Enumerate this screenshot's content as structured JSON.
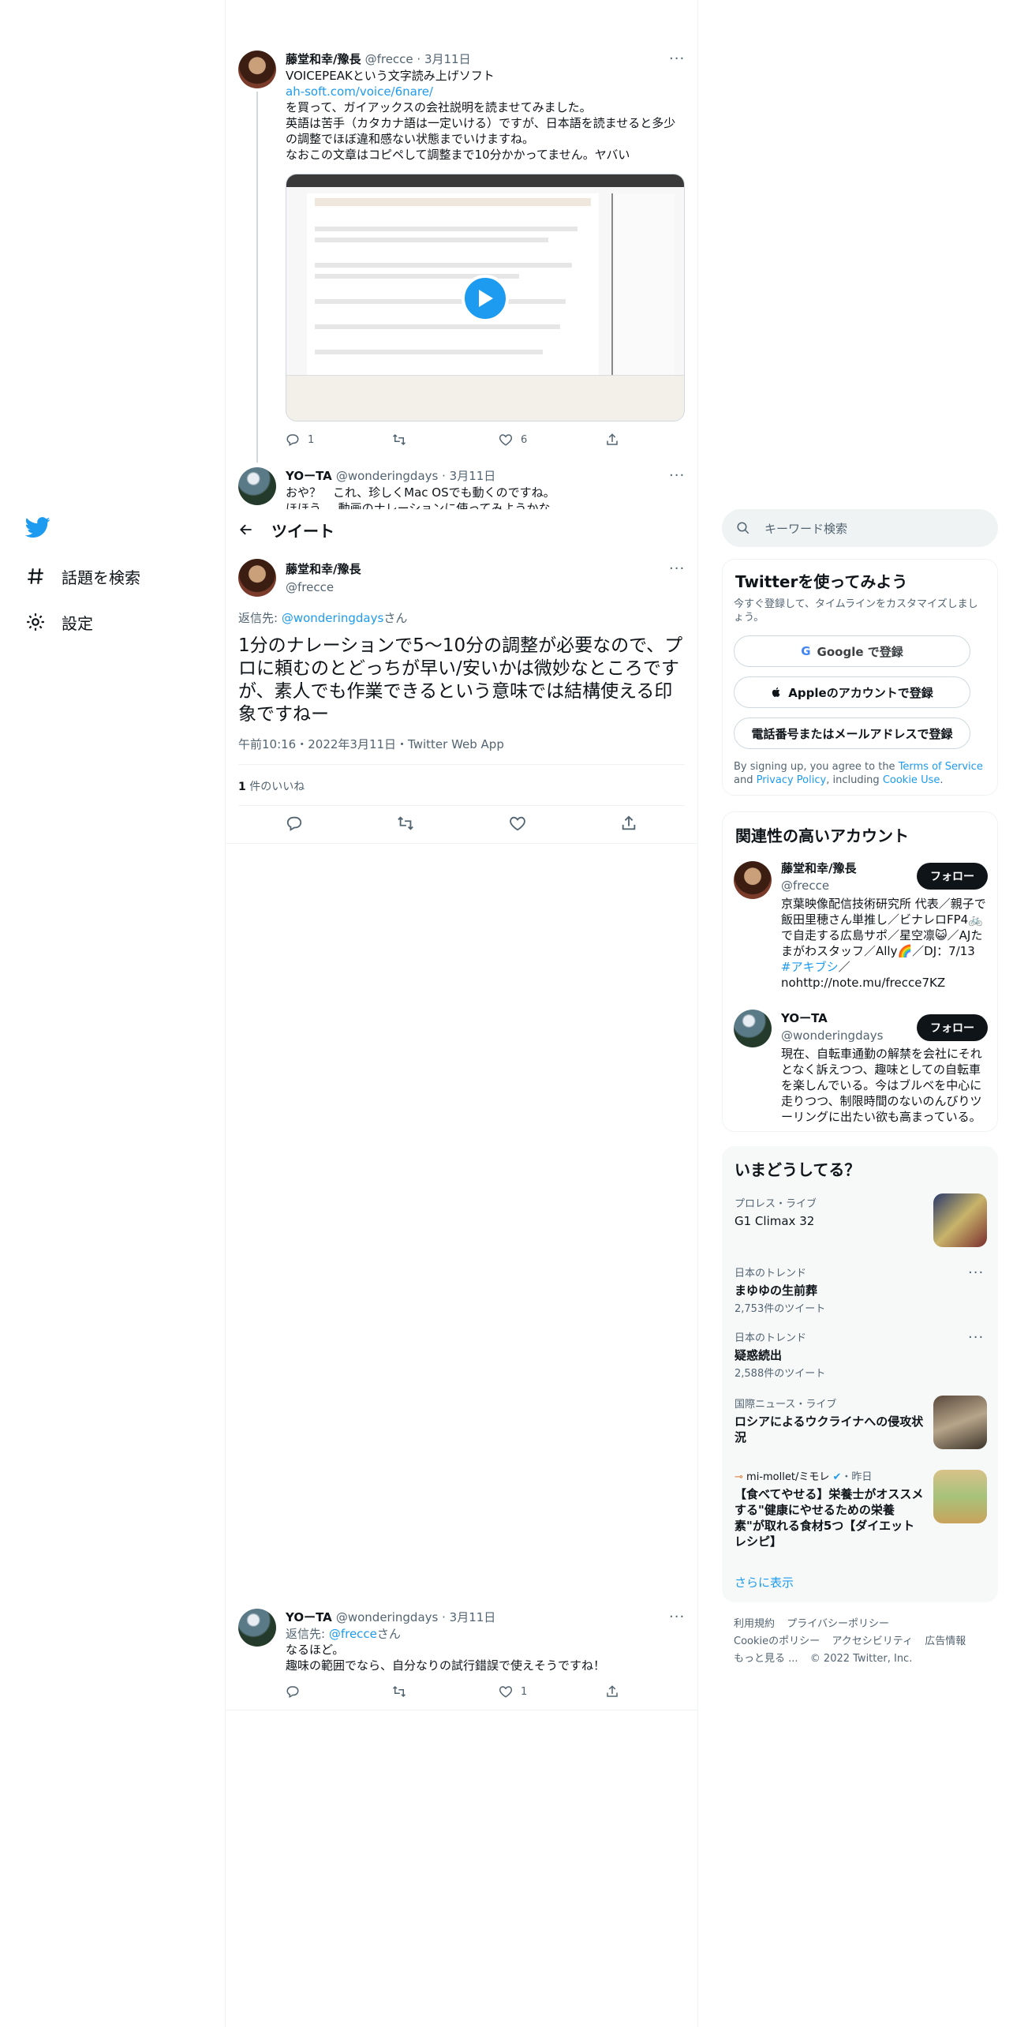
{
  "nav": {
    "explore_label": "話題を検索",
    "settings_label": "設定"
  },
  "header": {
    "title": "ツイート"
  },
  "tweet1": {
    "name": "藤堂和幸/豫長",
    "handle": "@frecce",
    "date": "3月11日",
    "line1": "VOICEPEAKという文字読み上げソフト",
    "link": "ah-soft.com/voice/6nare/",
    "line2": "を買って、ガイアックスの会社説明を読ませてみました。",
    "line3": "英語は苦手（カタカナ語は一定いける）ですが、日本語を読ませると多少",
    "line4": "の調整でほぼ違和感ない状態までいけますね。",
    "line5": "なおこの文章はコピペして調整まで10分かかってません。ヤバい",
    "reply_count": "1",
    "retweet_count": "",
    "like_count": "6"
  },
  "tweet2": {
    "name": "YOーTA",
    "handle": "@wonderingdays",
    "date": "3月11日",
    "line1": "おや？　これ、珍しくMac OSでも動くのですね。",
    "line2": "ほほう。。動画のナレーションに使ってみようかな"
  },
  "focus": {
    "name": "藤堂和幸/豫長",
    "handle": "@frecce",
    "reply_prefix": "返信先: ",
    "reply_to": "@wonderingdays",
    "reply_suffix": "さん",
    "text": "1分のナレーションで5〜10分の調整が必要なので、プロに頼むのとどっちが早い/安いかは微妙なところですが、素人でも作業できるという意味では結構使える印象ですねー",
    "time": "午前10:16・2022年3月11日・Twitter Web App",
    "likes_count": "1",
    "likes_label": " 件のいいね"
  },
  "tweet3": {
    "name": "YOーTA",
    "handle": "@wonderingdays",
    "date": "3月11日",
    "reply_prefix": "返信先: ",
    "reply_to": "@frecce",
    "reply_suffix": "さん",
    "line1": "なるほど。",
    "line2": "趣味の範囲でなら、自分なりの試行錯誤で使えそうですね！",
    "like_count": "1"
  },
  "search": {
    "placeholder": "キーワード検索"
  },
  "signup": {
    "title": "Twitterを使ってみよう",
    "subtitle": "今すぐ登録して、タイムラインをカスタマイズしましょう。",
    "google": "Google で登録",
    "apple": "Appleのアカウントで登録",
    "phone": "電話番号またはメールアドレスで登録",
    "legal_1": "By signing up, you agree to the ",
    "terms": "Terms of Service",
    "legal_2": " and ",
    "privacy": "Privacy Policy",
    "legal_3": ", including ",
    "cookie": "Cookie Use",
    "legal_4": "."
  },
  "related": {
    "title": "関連性の高いアカウント",
    "follow_label": "フォロー",
    "a1_name": "藤堂和幸/豫長",
    "a1_handle": "@frecce",
    "a1_bio_1": "京葉映像配信技術研究所 代表／親子で飯田里穂さん単推し／ビナレロFP4",
    "a1_bio_2": "🚲で自走する広島サポ／星空凛😺／AJたまがわスタッフ／Ally🌈／DJ：7/13 ",
    "a1_hashtag": "#アキブシ",
    "a1_bio_3": "／nohttp://note.mu/frecce7KZ",
    "a2_name": "YOーTA",
    "a2_handle": "@wonderingdays",
    "a2_bio": "現在、自転車通勤の解禁を会社にそれとなく訴えつつ、趣味としての自転車を楽しんでいる。今はブルベを中心に走りつつ、制限時間のないのんびりツーリングに出たい欲も高まっている。"
  },
  "trends": {
    "title": "いまどうしてる？",
    "t1_cat": "プロレス・ライブ",
    "t1_title": "G1 Climax 32",
    "t2_cat": "日本のトレンド",
    "t2_title": "まゆゆの生前葬",
    "t2_count": "2,753件のツイート",
    "t3_cat": "日本のトレンド",
    "t3_title": "疑惑続出",
    "t3_count": "2,588件のツイート",
    "t4_cat": "国際ニュース・ライブ",
    "t4_title": "ロシアによるウクライナへの侵攻状況",
    "t5_source": "mi-mollet/ミモレ",
    "t5_time": "・昨日",
    "t5_title": "【食べてやせる】栄養士がオススメする\"健康にやせるための栄養素\"が取れる食材5つ【ダイエットレシピ】",
    "show_more": "さらに表示"
  },
  "footer": {
    "terms": "利用規約",
    "privacy": "プライバシーポリシー",
    "cookie": "Cookieのポリシー",
    "accessibility": "アクセシビリティ",
    "ads": "広告情報",
    "more": "もっと見る ...",
    "copyright": "© 2022 Twitter, Inc."
  },
  "colors": {
    "accent": "#1d9bf0",
    "text": "#0f1419",
    "muted": "#536471"
  }
}
